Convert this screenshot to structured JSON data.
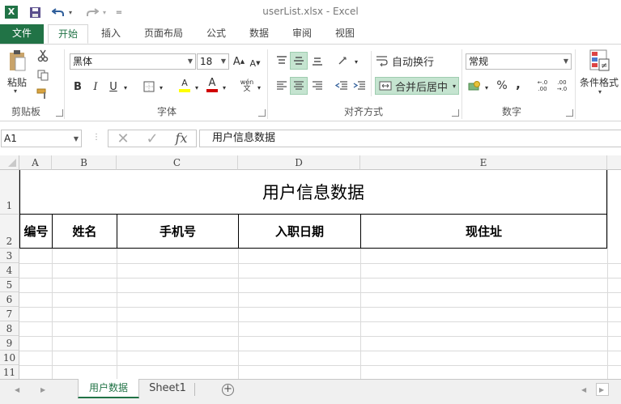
{
  "titlebar": {
    "title": "userList.xlsx - Excel",
    "more": "="
  },
  "tabs": [
    {
      "label": "文件"
    },
    {
      "label": "开始"
    },
    {
      "label": "插入"
    },
    {
      "label": "页面布局"
    },
    {
      "label": "公式"
    },
    {
      "label": "数据"
    },
    {
      "label": "审阅"
    },
    {
      "label": "视图"
    }
  ],
  "ribbon": {
    "clipboard": {
      "paste": "粘贴",
      "group": "剪贴板"
    },
    "font": {
      "name": "黑体",
      "size": "18",
      "bold": "B",
      "italic": "I",
      "underline": "U",
      "fill_letter": "A",
      "font_letter": "A",
      "phonetic": "wén",
      "group": "字体",
      "grow": "A",
      "shrink": "A"
    },
    "alignment": {
      "wrap": "自动换行",
      "merge": "合并后居中",
      "group": "对齐方式"
    },
    "number": {
      "format": "常规",
      "percent": "%",
      "comma": ",",
      "inc": ".0\n.00",
      "group": "数字"
    },
    "styles": {
      "conditional": "条件格式"
    }
  },
  "formula_bar": {
    "name_box": "A1",
    "formula": "用户信息数据",
    "fx": "fx"
  },
  "sheet": {
    "columns": [
      "A",
      "B",
      "C",
      "D",
      "E"
    ],
    "rows": [
      "1",
      "2",
      "3",
      "4",
      "5",
      "6",
      "7",
      "8",
      "9",
      "10",
      "11"
    ],
    "title": "用户信息数据",
    "headers": [
      "编号",
      "姓名",
      "手机号",
      "入职日期",
      "现住址"
    ]
  },
  "sheet_tabs": [
    {
      "label": "用户数据"
    },
    {
      "label": "Sheet1"
    }
  ],
  "colors": {
    "accent": "#217346",
    "merge_highlight": "#c5e4d0"
  }
}
